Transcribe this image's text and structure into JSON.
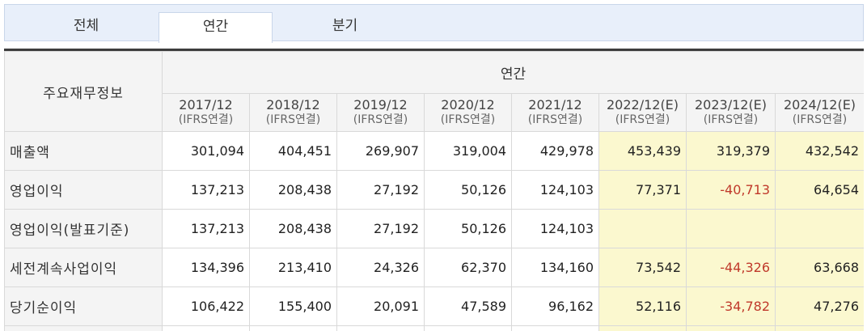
{
  "tabs": [
    {
      "label": "전체"
    },
    {
      "label": "연간"
    },
    {
      "label": "분기"
    }
  ],
  "table": {
    "corner_label": "주요재무정보",
    "group_label": "연간",
    "periods": [
      {
        "year": "2017/12",
        "basis": "(IFRS연결)"
      },
      {
        "year": "2018/12",
        "basis": "(IFRS연결)"
      },
      {
        "year": "2019/12",
        "basis": "(IFRS연결)"
      },
      {
        "year": "2020/12",
        "basis": "(IFRS연결)"
      },
      {
        "year": "2021/12",
        "basis": "(IFRS연결)"
      },
      {
        "year": "2022/12(E)",
        "basis": "(IFRS연결)"
      },
      {
        "year": "2023/12(E)",
        "basis": "(IFRS연결)"
      },
      {
        "year": "2024/12(E)",
        "basis": "(IFRS연결)"
      }
    ],
    "rows": [
      {
        "label": "매출액",
        "values": [
          "301,094",
          "404,451",
          "269,907",
          "319,004",
          "429,978",
          "453,439",
          "319,379",
          "432,542"
        ]
      },
      {
        "label": "영업이익",
        "values": [
          "137,213",
          "208,438",
          "27,192",
          "50,126",
          "124,103",
          "77,371",
          "-40,713",
          "64,654"
        ]
      },
      {
        "label": "영업이익(발표기준)",
        "values": [
          "137,213",
          "208,438",
          "27,192",
          "50,126",
          "124,103",
          "",
          "",
          ""
        ]
      },
      {
        "label": "세전계속사업이익",
        "values": [
          "134,396",
          "213,410",
          "24,326",
          "62,370",
          "134,160",
          "73,542",
          "-44,326",
          "63,668"
        ]
      },
      {
        "label": "당기순이익",
        "values": [
          "106,422",
          "155,400",
          "20,091",
          "47,589",
          "96,162",
          "52,116",
          "-34,782",
          "47,276"
        ]
      }
    ],
    "estimate_color": "#fbf8cf",
    "negative_color": "#c0392b"
  }
}
